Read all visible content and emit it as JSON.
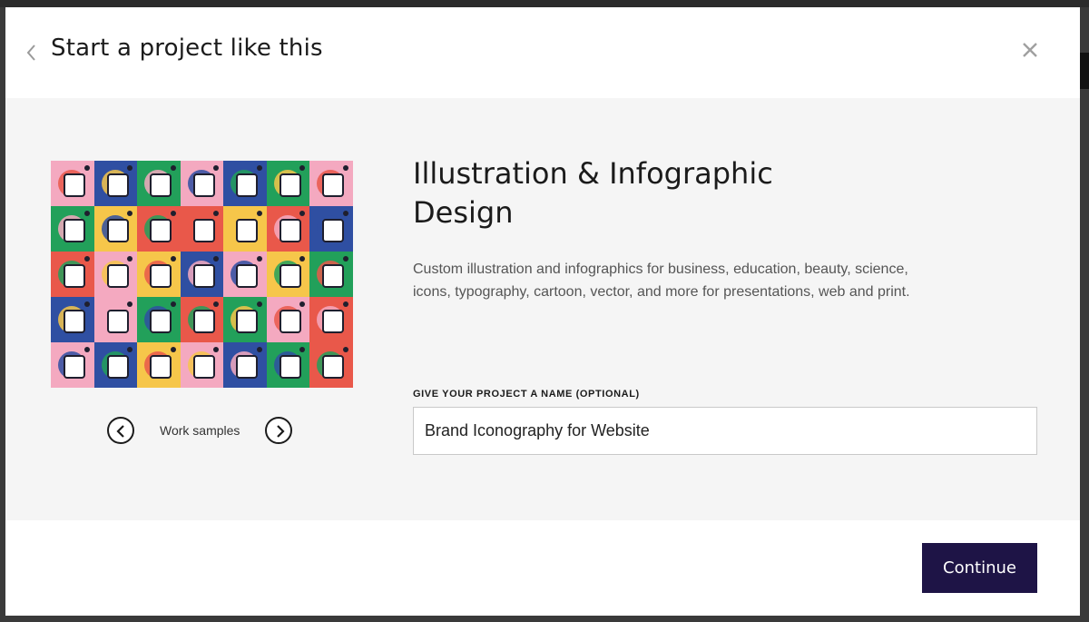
{
  "modal": {
    "title": "Start a project like this",
    "back_icon": "chevron-left-icon",
    "close_icon": "close-icon"
  },
  "samples": {
    "label": "Work samples",
    "prev_icon": "chevron-left-circle-icon",
    "next_icon": "chevron-right-circle-icon"
  },
  "service": {
    "title": "Illustration & Infographic Design",
    "description": "Custom illustration and infographics for business, education, beauty, science, icons, typography, cartoon, vector, and more for presentations, web and print."
  },
  "project_name": {
    "label": "GIVE YOUR PROJECT A NAME (OPTIONAL)",
    "value": "Brand Iconography for Website"
  },
  "actions": {
    "continue_label": "Continue"
  },
  "colors": {
    "primary_button": "#1e1446",
    "body_background": "#f5f5f5",
    "tile_palette": [
      "#f4a9c0",
      "#2f4fa2",
      "#22a05a",
      "#f6c64a",
      "#e9584a"
    ]
  }
}
